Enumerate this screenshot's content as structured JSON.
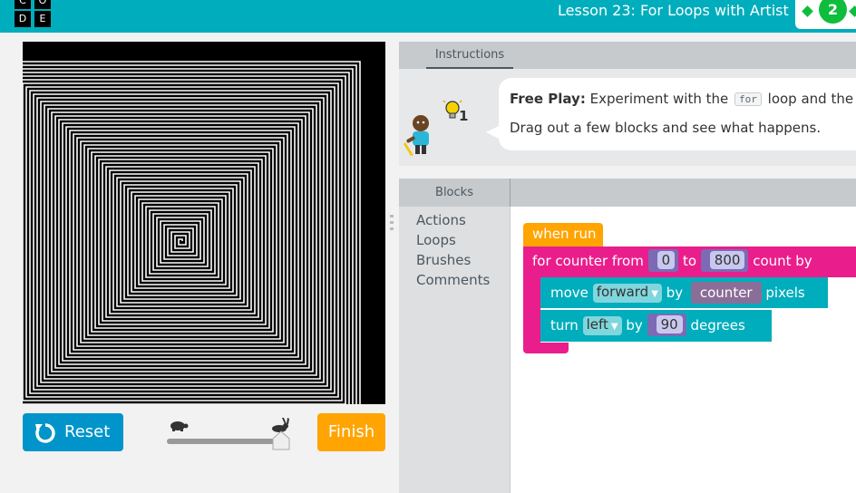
{
  "header": {
    "logo_letters": [
      "C",
      "O",
      "D",
      "E"
    ],
    "lesson_title": "Lesson 23: For Loops with Artist",
    "level_number": "2",
    "accent_color": "#00adbc",
    "progress_color": "#0fbd3d"
  },
  "controls": {
    "reset_label": "Reset",
    "finish_label": "Finish",
    "speed_slider_icon_slow": "turtle-icon",
    "speed_slider_icon_fast": "rabbit-icon",
    "speed_level": 1.0
  },
  "instructions": {
    "tab_label": "Instructions",
    "hint_count": "1",
    "bold_prefix": "Free Play:",
    "text_before_code": " Experiment with the ",
    "code_word": "for",
    "text_after_code": " loop and the",
    "line2": "Drag out a few blocks and see what happens."
  },
  "toolbox": {
    "header": "Blocks",
    "categories": [
      "Actions",
      "Loops",
      "Brushes",
      "Comments"
    ]
  },
  "blocks": {
    "when_run": "when run",
    "for_loop": {
      "kw_for": "for",
      "variable": "counter",
      "kw_from": "from",
      "from_value": "0",
      "kw_to": "to",
      "to_value": "800",
      "kw_count_by": "count by"
    },
    "move": {
      "kw_move": "move",
      "direction": "forward",
      "kw_by": "by",
      "amount_variable": "counter",
      "unit": "pixels"
    },
    "turn": {
      "kw_turn": "turn",
      "direction": "left",
      "kw_by": "by",
      "angle": "90",
      "unit": "degrees"
    }
  }
}
